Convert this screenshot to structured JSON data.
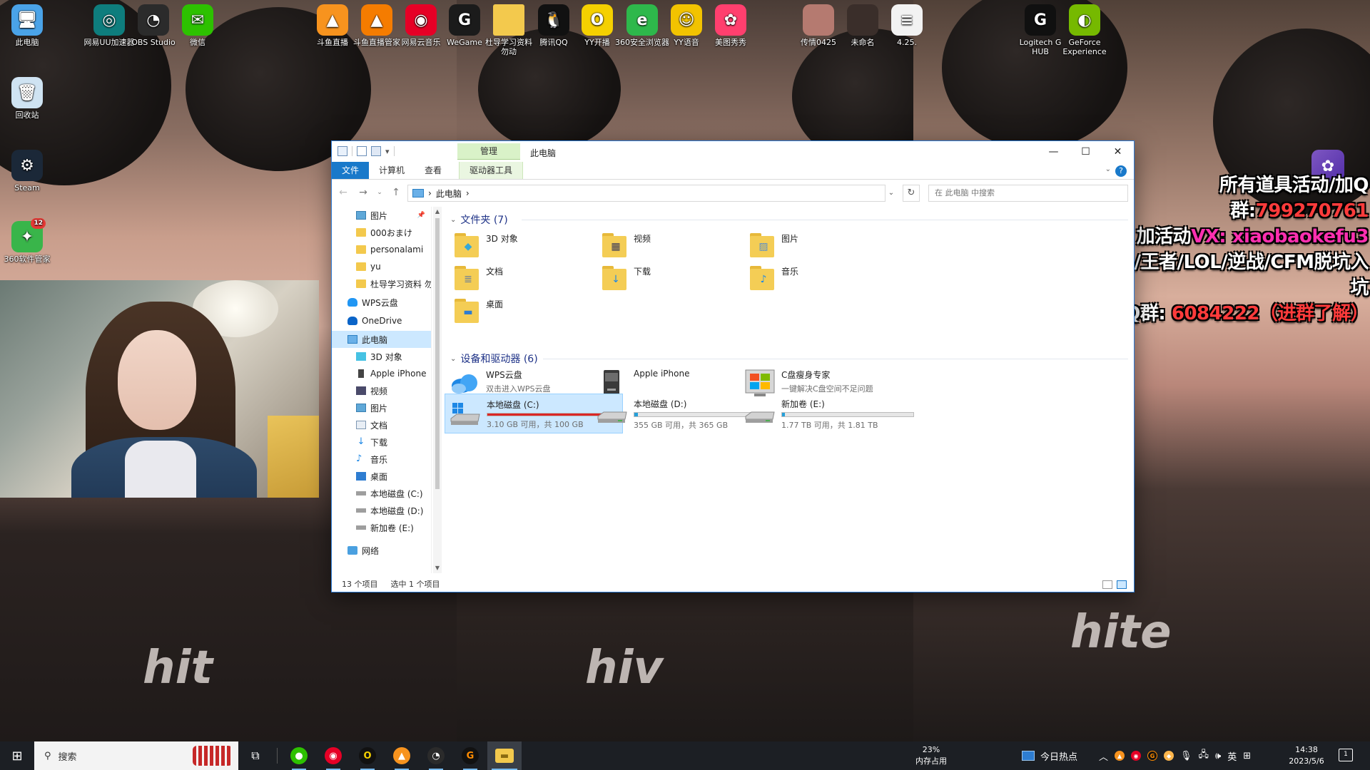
{
  "desktop": {
    "icons_top": [
      {
        "label": "此电脑",
        "icon": "this-pc-icon",
        "color": "#4aa3e8"
      },
      {
        "label": "网易UU加速器",
        "icon": "uu-booster-icon",
        "color": "#0e7d7d"
      },
      {
        "label": "OBS Studio",
        "icon": "obs-icon",
        "color": "#2b2b2b"
      },
      {
        "label": "微信",
        "icon": "wechat-icon",
        "color": "#2dc100"
      },
      {
        "label": "斗鱼直播",
        "icon": "douyu-live-icon",
        "color": "#f7931e"
      },
      {
        "label": "斗鱼直播管家",
        "icon": "douyu-manager-icon",
        "color": "#f57c00"
      },
      {
        "label": "网易云音乐",
        "icon": "netease-music-icon",
        "color": "#e60026"
      },
      {
        "label": "WeGame",
        "icon": "wegame-icon",
        "color": "#1b1b1b"
      },
      {
        "label": "杜导学习资料勿动",
        "icon": "folder-icon",
        "color": "#f3c94d"
      },
      {
        "label": "腾讯QQ",
        "icon": "qq-icon",
        "color": "#111111"
      },
      {
        "label": "YY开播",
        "icon": "yy-live-icon",
        "color": "#f5d000"
      },
      {
        "label": "360安全浏览器",
        "icon": "360-browser-icon",
        "color": "#2eb84b"
      },
      {
        "label": "YY语音",
        "icon": "yy-voice-icon",
        "color": "#f2c300"
      },
      {
        "label": "美图秀秀",
        "icon": "meitu-icon",
        "color": "#ff3f6e"
      },
      {
        "label": "传情0425",
        "icon": "image-file-icon",
        "color": "#b57a70"
      },
      {
        "label": "未命名",
        "icon": "image-file-icon",
        "color": "#3a2e2a"
      },
      {
        "label": "4.25.",
        "icon": "document-file-icon",
        "color": "#f2f2f2"
      },
      {
        "label": "Logitech G HUB",
        "icon": "logitech-icon",
        "color": "#101010"
      },
      {
        "label": "GeForce Experience",
        "icon": "geforce-icon",
        "color": "#76b900"
      }
    ],
    "icons_left": [
      {
        "label": "回收站",
        "icon": "recycle-bin-icon",
        "color": "#cfe3f2"
      },
      {
        "label": "Steam",
        "icon": "steam-icon",
        "color": "#1b2838"
      },
      {
        "label": "360软件管家",
        "icon": "360-software-icon",
        "color": "#39b54a",
        "badge": "12"
      }
    ]
  },
  "promo": {
    "line1_a": "所有道具活动/加Q群:",
    "line1_b": "799270761",
    "line2_a": "加活动",
    "line2_b": "VX: xiaobaokefu3",
    "line3": "CF/王者/LOL/逆战/CFM脱坑入坑",
    "line4_a": "加Q群: ",
    "line4_b": "6084222（进群了解）"
  },
  "explorer": {
    "title": "此电脑",
    "context_tab_head": "管理",
    "ribbon_tabs": [
      "文件",
      "计算机",
      "查看",
      "驱动器工具"
    ],
    "address_path": "此电脑",
    "search_placeholder": "在 此电脑 中搜索",
    "nav_items": [
      {
        "label": "图片",
        "icon": "pictures-icon",
        "pinned": true
      },
      {
        "label": "000おまけ",
        "icon": "folder-icon"
      },
      {
        "label": "personalami",
        "icon": "folder-icon"
      },
      {
        "label": "yu",
        "icon": "folder-icon"
      },
      {
        "label": "杜导学习资料 勿",
        "icon": "folder-icon"
      },
      {
        "label": "WPS云盘",
        "icon": "wps-cloud-icon",
        "top": true
      },
      {
        "label": "OneDrive",
        "icon": "onedrive-icon",
        "top": true
      },
      {
        "label": "此电脑",
        "icon": "this-pc-icon",
        "top": true,
        "selected": true
      },
      {
        "label": "3D 对象",
        "icon": "3d-objects-icon"
      },
      {
        "label": "Apple iPhone",
        "icon": "iphone-icon"
      },
      {
        "label": "视频",
        "icon": "videos-icon"
      },
      {
        "label": "图片",
        "icon": "pictures-icon"
      },
      {
        "label": "文档",
        "icon": "documents-icon"
      },
      {
        "label": "下载",
        "icon": "downloads-icon"
      },
      {
        "label": "音乐",
        "icon": "music-icon"
      },
      {
        "label": "桌面",
        "icon": "desktop-icon"
      },
      {
        "label": "本地磁盘 (C:)",
        "icon": "drive-icon"
      },
      {
        "label": "本地磁盘 (D:)",
        "icon": "drive-icon"
      },
      {
        "label": "新加卷 (E:)",
        "icon": "drive-icon"
      },
      {
        "label": "网络",
        "icon": "network-icon",
        "top": true
      }
    ],
    "folders_header": "文件夹 (7)",
    "folders": [
      {
        "label": "3D 对象",
        "icon": "3d-objects-icon"
      },
      {
        "label": "视频",
        "icon": "videos-icon"
      },
      {
        "label": "图片",
        "icon": "pictures-icon"
      },
      {
        "label": "文档",
        "icon": "documents-icon"
      },
      {
        "label": "下载",
        "icon": "downloads-icon"
      },
      {
        "label": "音乐",
        "icon": "music-icon"
      },
      {
        "label": "桌面",
        "icon": "desktop-icon"
      }
    ],
    "devices_header": "设备和驱动器 (6)",
    "devices": [
      {
        "name": "WPS云盘",
        "sub": "双击进入WPS云盘",
        "icon": "wps-cloud-icon"
      },
      {
        "name": "Apple iPhone",
        "sub": "",
        "icon": "iphone-icon"
      },
      {
        "name": "C盘瘦身专家",
        "sub": "一键解决C盘空间不足问题",
        "icon": "c-drive-cleaner-icon"
      },
      {
        "name": "本地磁盘 (C:)",
        "sub": "3.10 GB 可用，共 100 GB",
        "icon": "windows-drive-icon",
        "used_fraction": 0.969,
        "selected": true
      },
      {
        "name": "本地磁盘 (D:)",
        "sub": "355 GB 可用，共 365 GB",
        "icon": "drive-icon",
        "used_fraction": 0.027
      },
      {
        "name": "新加卷 (E:)",
        "sub": "1.77 TB 可用，共 1.81 TB",
        "icon": "drive-icon",
        "used_fraction": 0.022
      }
    ],
    "status_count": "13 个项目",
    "status_selected": "选中 1 个项目"
  },
  "taskbar": {
    "search_text": "搜索",
    "apps": [
      {
        "name": "wechat-icon",
        "glyph": "●",
        "color": "#2dc100",
        "fg": "#fff"
      },
      {
        "name": "netease-music-icon",
        "glyph": "◉",
        "color": "#e60026",
        "fg": "#fff"
      },
      {
        "name": "yy-live-icon",
        "glyph": "O",
        "color": "#111",
        "fg": "#f5d000"
      },
      {
        "name": "douyu-live-icon",
        "glyph": "▲",
        "color": "#f7931e",
        "fg": "#fff"
      },
      {
        "name": "obs-icon",
        "glyph": "◔",
        "color": "#2b2b2b",
        "fg": "#fff"
      },
      {
        "name": "wegame-icon",
        "glyph": "G",
        "color": "#111",
        "fg": "#ff8c00"
      },
      {
        "name": "file-explorer-icon",
        "glyph": "▬",
        "color": "#f3c94d",
        "fg": "#8a6a10",
        "active": true
      }
    ],
    "memory_percent": "23%",
    "memory_label": "内存占用",
    "news": "今日热点",
    "ime": "英",
    "time": "14:38",
    "date": "2023/5/6",
    "notify_count": "1"
  }
}
